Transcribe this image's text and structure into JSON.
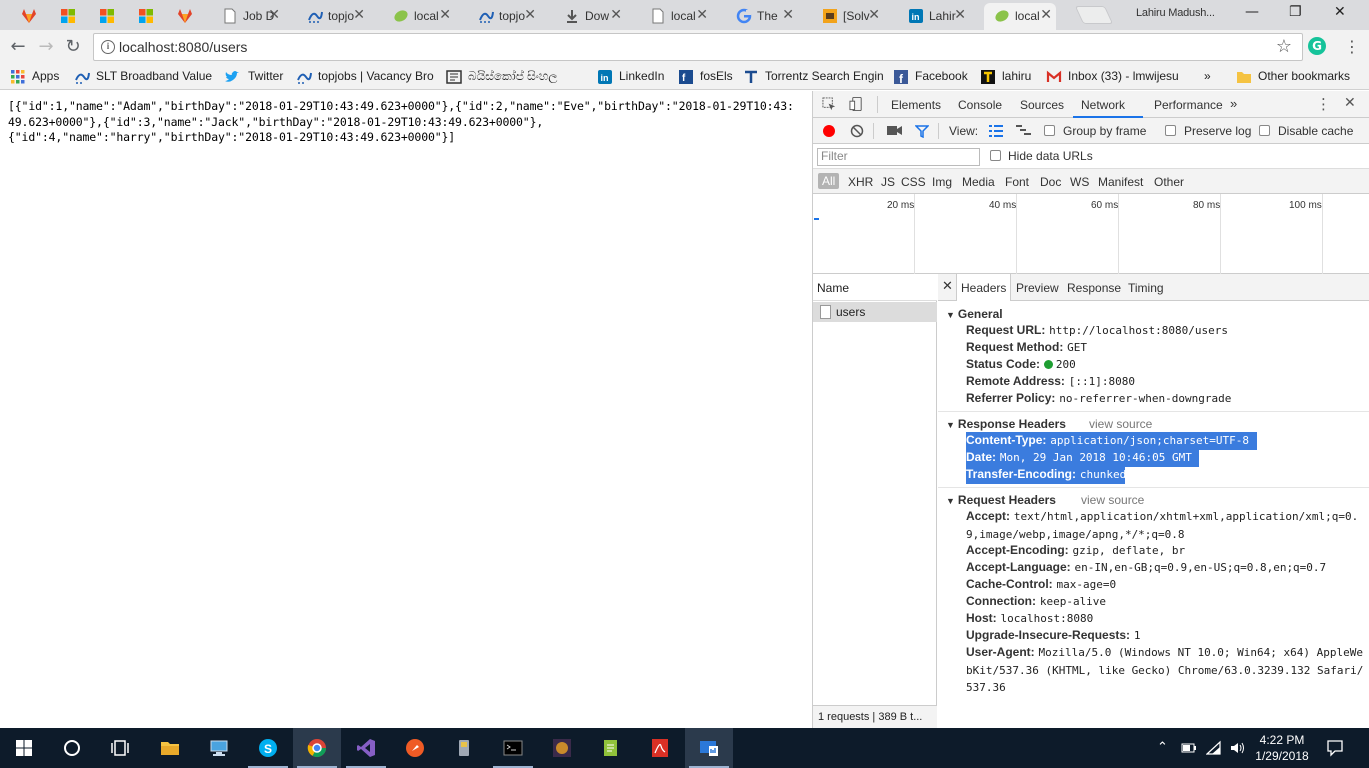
{
  "browser": {
    "tabs": [
      {
        "title": "",
        "icon": "gitlab-icon"
      },
      {
        "title": "",
        "icon": "microsoft-icon"
      },
      {
        "title": "",
        "icon": "microsoft-icon"
      },
      {
        "title": "",
        "icon": "microsoft-icon"
      },
      {
        "title": "",
        "icon": "gitlab-icon"
      },
      {
        "title": "Job D",
        "icon": "page-icon"
      },
      {
        "title": "topjo",
        "icon": "topjobs-icon"
      },
      {
        "title": "local",
        "icon": "spring-icon"
      },
      {
        "title": "topjo",
        "icon": "topjobs-icon"
      },
      {
        "title": "Dow",
        "icon": "download-icon"
      },
      {
        "title": "local",
        "icon": "page-icon"
      },
      {
        "title": "The",
        "icon": "google-icon"
      },
      {
        "title": "[Solv",
        "icon": "stackoverflow-icon"
      },
      {
        "title": "Lahir",
        "icon": "linkedin-icon"
      },
      {
        "title": "local",
        "icon": "spring-icon"
      }
    ],
    "profile_name": "Lahiru Madush...",
    "url": "localhost:8080/users"
  },
  "bookmarks": [
    {
      "label": "Apps",
      "icon": "apps-grid-icon"
    },
    {
      "label": "SLT Broadband Value",
      "icon": "topjobs-icon"
    },
    {
      "label": "Twitter",
      "icon": "twitter-icon"
    },
    {
      "label": "topjobs | Vacancy Bro",
      "icon": "topjobs-icon"
    },
    {
      "label": "බයිස්කෝප් සිංහල",
      "icon": "bioscope-icon"
    },
    {
      "label": "LinkedIn",
      "icon": "linkedin-icon"
    },
    {
      "label": "fosEls",
      "icon": "fosels-icon"
    },
    {
      "label": "Torrentz Search Engin",
      "icon": "torrentz-icon"
    },
    {
      "label": "Facebook",
      "icon": "facebook-icon"
    },
    {
      "label": "lahiru",
      "icon": "lahiru-icon"
    },
    {
      "label": "Inbox (33) - lmwijesu",
      "icon": "gmail-icon"
    },
    {
      "label": "»",
      "icon": ""
    },
    {
      "label": "Other bookmarks",
      "icon": "folder-icon"
    }
  ],
  "page": {
    "json_text": "[{\"id\":1,\"name\":\"Adam\",\"birthDay\":\"2018-01-29T10:43:49.623+0000\"},{\"id\":2,\"name\":\"Eve\",\"birthDay\":\"2018-01-29T10:43:49.623+0000\"},{\"id\":3,\"name\":\"Jack\",\"birthDay\":\"2018-01-29T10:43:49.623+0000\"},\n{\"id\":4,\"name\":\"harry\",\"birthDay\":\"2018-01-29T10:43:49.623+0000\"}]"
  },
  "devtools": {
    "tabs": [
      "Elements",
      "Console",
      "Sources",
      "Network",
      "Performance",
      "»"
    ],
    "active_tab": "Network",
    "view_label": "View:",
    "group_by_frame": "Group by frame",
    "preserve_log": "Preserve log",
    "disable_cache": "Disable cache",
    "filter_placeholder": "Filter",
    "hide_data_urls": "Hide data URLs",
    "types": [
      "All",
      "XHR",
      "JS",
      "CSS",
      "Img",
      "Media",
      "Font",
      "Doc",
      "WS",
      "Manifest",
      "Other"
    ],
    "timeline_ticks": [
      "20 ms",
      "40 ms",
      "60 ms",
      "80 ms",
      "100 ms"
    ],
    "name_header": "Name",
    "requests": [
      {
        "name": "users"
      }
    ],
    "summary": "1 requests  |  389 B t...",
    "detail_tabs": [
      "Headers",
      "Preview",
      "Response",
      "Timing"
    ],
    "general": {
      "title": "General",
      "rows": [
        {
          "k": "Request URL:",
          "v": "http://localhost:8080/users"
        },
        {
          "k": "Request Method:",
          "v": "GET"
        },
        {
          "k": "Status Code:",
          "v": "200"
        },
        {
          "k": "Remote Address:",
          "v": "[::1]:8080"
        },
        {
          "k": "Referrer Policy:",
          "v": "no-referrer-when-downgrade"
        }
      ]
    },
    "response_headers": {
      "title": "Response Headers",
      "view_source": "view source",
      "rows": [
        {
          "k": "Content-Type:",
          "v": "application/json;charset=UTF-8"
        },
        {
          "k": "Date:",
          "v": "Mon, 29 Jan 2018 10:46:05 GMT"
        },
        {
          "k": "Transfer-Encoding:",
          "v": "chunked"
        }
      ]
    },
    "request_headers": {
      "title": "Request Headers",
      "view_source": "view source",
      "rows": [
        {
          "k": "Accept:",
          "v": "text/html,application/xhtml+xml,application/xml;q=0.9,image/webp,image/apng,*/*;q=0.8"
        },
        {
          "k": "Accept-Encoding:",
          "v": "gzip, deflate, br"
        },
        {
          "k": "Accept-Language:",
          "v": "en-IN,en-GB;q=0.9,en-US;q=0.8,en;q=0.7"
        },
        {
          "k": "Cache-Control:",
          "v": "max-age=0"
        },
        {
          "k": "Connection:",
          "v": "keep-alive"
        },
        {
          "k": "Host:",
          "v": "localhost:8080"
        },
        {
          "k": "Upgrade-Insecure-Requests:",
          "v": "1"
        },
        {
          "k": "User-Agent:",
          "v": "Mozilla/5.0 (Windows NT 10.0; Win64; x64) AppleWebKit/537.36 (KHTML, like Gecko) Chrome/63.0.3239.132 Safari/537.36"
        }
      ]
    }
  },
  "taskbar": {
    "time": "4:22 PM",
    "date": "1/29/2018"
  },
  "colors": {
    "record": "#ff0000",
    "selection": "#3b7cde",
    "status_ok": "#1e9e32",
    "taskbar": "#0d1b2a"
  }
}
